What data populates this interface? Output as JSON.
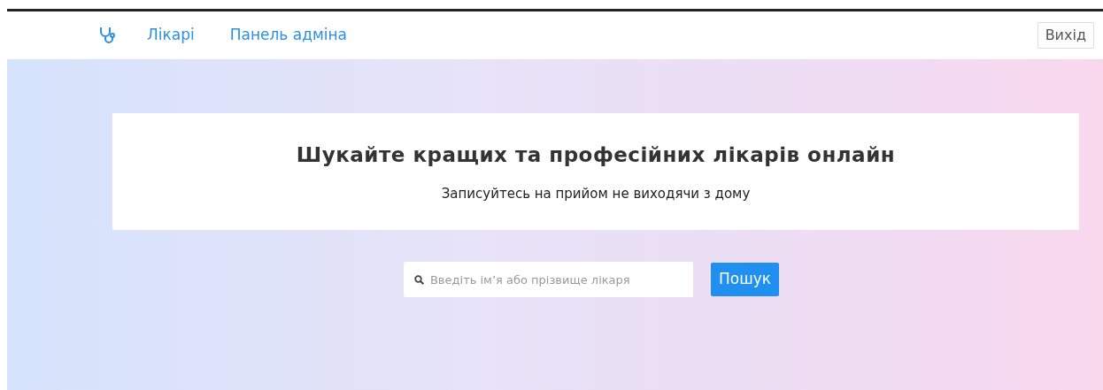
{
  "nav": {
    "links": [
      {
        "label": "Лікарі"
      },
      {
        "label": "Панель адміна"
      }
    ],
    "logout": "Вихід"
  },
  "hero": {
    "title": "Шукайте кращих та професійних лікарів онлайн",
    "subtitle": "Записуйтесь на прийом не виходячи з дому"
  },
  "search": {
    "placeholder": "Введіть ім’я або прізвище лікаря",
    "button": "Пошук"
  }
}
